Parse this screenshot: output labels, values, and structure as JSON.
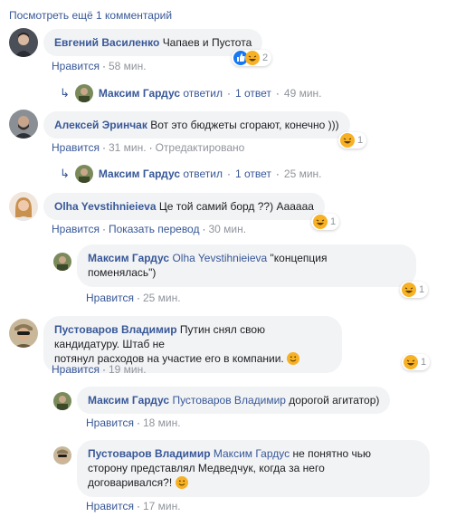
{
  "more_comments": "Посмотреть ещё 1 комментарий",
  "labels": {
    "like": "Нравится",
    "dot": "·"
  },
  "comments": [
    {
      "author": "Евгений Василенко",
      "text": "Чапаев и Пустота",
      "time": "58 мин.",
      "reactions_count": "2",
      "reply_summary": {
        "name": "Максим Гардус",
        "action": "ответил",
        "count": "1 ответ",
        "time": "49 мин."
      }
    },
    {
      "author": "Алексей Эринчак",
      "text": "Вот это бюджеты сгорают, конечно )))",
      "time": "31 мин.",
      "edited": "Отредактировано",
      "reactions_count": "1",
      "reply_summary": {
        "name": "Максим Гардус",
        "action": "ответил",
        "count": "1 ответ",
        "time": "25 мин."
      }
    },
    {
      "author": "Olha Yevstihnieieva",
      "text": "Це той самий борд ??) Аааааа",
      "time": "30 мин.",
      "translate": "Показать перевод",
      "reactions_count": "1",
      "replies": [
        {
          "author": "Максим Гардус",
          "mention": "Olha Yevstihnieieva",
          "text_line1": "\"концепция",
          "text_line2": "поменялась\")",
          "time": "25 мин.",
          "reactions_count": "1"
        }
      ]
    },
    {
      "author": "Пустоваров Владимир",
      "text_line1": "Путин снял свою кандидатуру. Штаб не",
      "text_line2": "потянул расходов на участие его в компании.",
      "time": "19 мин.",
      "reactions_count": "1",
      "replies": [
        {
          "author": "Максим Гардус",
          "mention": "Пустоваров Владимир",
          "text": "дорогой агитатор)",
          "time": "18 мин."
        },
        {
          "author": "Пустоваров Владимир",
          "mention": "Максим Гардус",
          "text_line1": "не понятно чью",
          "text_line2": "сторону представлял Медведчук, когда за него",
          "text_line3": "договаривался?!",
          "time": "17 мин."
        }
      ]
    }
  ]
}
